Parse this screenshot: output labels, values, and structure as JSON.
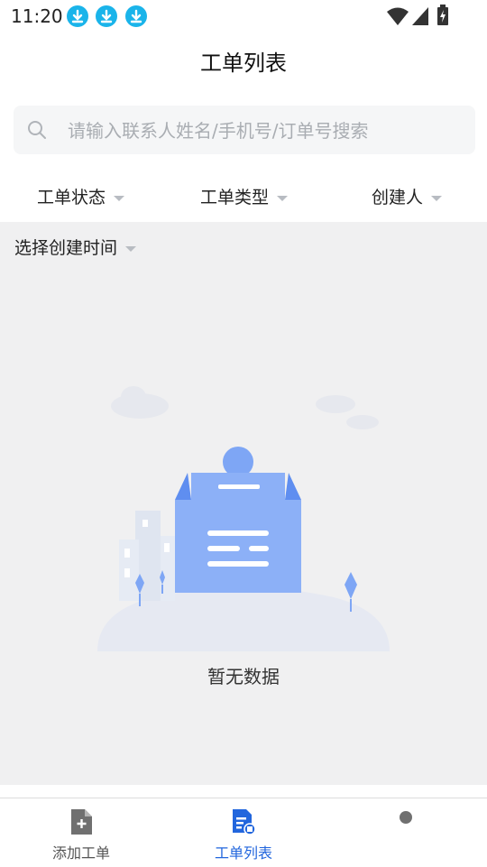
{
  "status_bar": {
    "time": "11:20",
    "notification_icons": [
      "download-icon",
      "download-icon",
      "download-icon"
    ],
    "right_icons": [
      "wifi-icon",
      "signal-icon",
      "battery-charging-icon"
    ]
  },
  "header": {
    "title": "工单列表"
  },
  "search": {
    "placeholder": "请输入联系人姓名/手机号/订单号搜索",
    "value": ""
  },
  "filters": {
    "status": "工单状态",
    "type": "工单类型",
    "creator": "创建人",
    "time": "选择创建时间"
  },
  "empty_state": {
    "text": "暂无数据"
  },
  "bottom_nav": {
    "items": [
      {
        "label": "添加工单",
        "icon": "add-document-icon",
        "active": false
      },
      {
        "label": "工单列表",
        "icon": "document-list-icon",
        "active": true
      },
      {
        "label": "",
        "icon": "profile-icon",
        "active": false
      }
    ]
  },
  "colors": {
    "accent": "#2266dd",
    "download_badge": "#1ab4ea",
    "illustration_blue": "#7ea6f5",
    "content_bg": "#f0f0f1"
  }
}
